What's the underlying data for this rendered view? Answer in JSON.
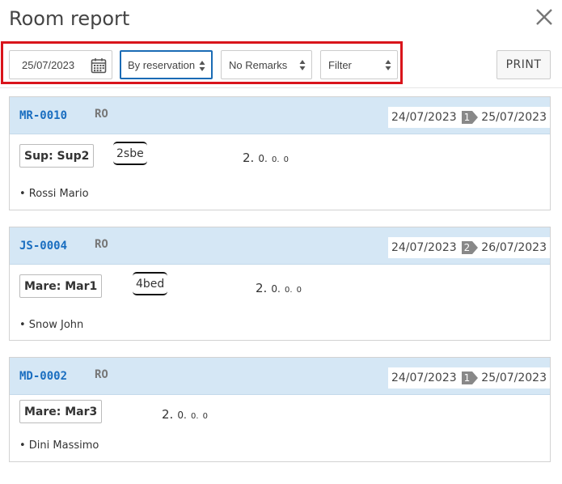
{
  "title": "Room report",
  "filters": {
    "date": "25/07/2023",
    "grouping": "By reservation",
    "remarks": "No Remarks",
    "filter": "Filter"
  },
  "print_label": "PRINT",
  "icons": {
    "close": "close-icon",
    "calendar": "calendar-icon",
    "select_arrows": "select-arrows-icon"
  },
  "colors": {
    "accent": "#1a6ec0",
    "highlight_frame": "#d9141b",
    "card_header": "#d5e7f5"
  },
  "reservations": [
    {
      "code": "MR-0010",
      "board": "RO",
      "arrival": "24/07/2023",
      "nights": "1",
      "departure": "25/07/2023",
      "room": "Sup: Sup2",
      "room_type": "2sbe",
      "pax": {
        "adults": "2.",
        "children": "0.",
        "infants1": "0.",
        "infants2": "0"
      },
      "guest": "• Rossi Mario"
    },
    {
      "code": "JS-0004",
      "board": "RO",
      "arrival": "24/07/2023",
      "nights": "2",
      "departure": "26/07/2023",
      "room": "Mare: Mar1",
      "room_type": "4bed",
      "pax": {
        "adults": "2.",
        "children": "0.",
        "infants1": "0.",
        "infants2": "0"
      },
      "guest": "• Snow John"
    },
    {
      "code": "MD-0002",
      "board": "RO",
      "arrival": "24/07/2023",
      "nights": "1",
      "departure": "25/07/2023",
      "room": "Mare: Mar3",
      "room_type": "",
      "pax": {
        "adults": "2.",
        "children": "0.",
        "infants1": "0.",
        "infants2": "0"
      },
      "guest": "• Dini Massimo"
    }
  ]
}
